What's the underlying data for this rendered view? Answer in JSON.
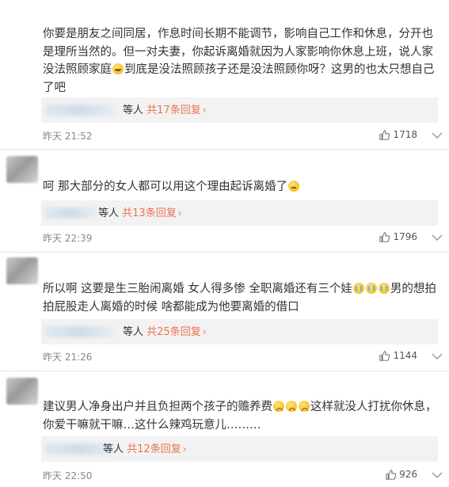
{
  "comments": [
    {
      "text_parts": [
        "你要是朋友之间同居，作息时间长期不能调节，影响自己工作和休息，分开也是理所当然的。但一对夫妻，你起诉离婚就因为人家影响你休息上班，说人家没法照顾家庭",
        "到底是没法照顾孩子还是没法照顾你呀？这男的也太只想自己了吧"
      ],
      "emoji_names": [
        "sweat-smile-emoji"
      ],
      "reply_suffix": "等人",
      "reply_count": "共17条回复",
      "time": "昨天 21:52",
      "likes": "1718"
    },
    {
      "text_parts": [
        "呵 那大部分的女人都可以用这个理由起诉离婚了",
        ""
      ],
      "emoji_names": [
        "thinking-emoji"
      ],
      "reply_suffix": "等人",
      "reply_count": "共13条回复",
      "time": "昨天 22:39",
      "likes": "1796"
    },
    {
      "text_parts": [
        "所以啊 这要是生三胎闹离婚 女人得多惨 全职离婚还有三个娃",
        "男的想拍拍屁股走人离婚的时候 啥都能成为他要离婚的借口"
      ],
      "emoji_names": [
        "crying-emoji",
        "crying-emoji",
        "crying-emoji"
      ],
      "reply_suffix": "等人",
      "reply_count": "共25条回复",
      "time": "昨天 21:26",
      "likes": "1144"
    },
    {
      "text_parts": [
        "建议男人净身出户并且负担两个孩子的赡养费",
        "这样就没人打扰你休息，你爱干嘛就干嘛…这什么辣鸡玩意儿………"
      ],
      "emoji_names": [
        "sad-emoji",
        "sad-emoji",
        "sad-emoji"
      ],
      "reply_suffix": "等人",
      "reply_count": "共12条回复",
      "time": "昨天 22:50",
      "likes": "926"
    }
  ],
  "colors": {
    "link": "#eb7350",
    "reply_bg": "#f2f2f2",
    "meta": "#888888"
  },
  "icons": {
    "like": "thumbs-up-icon",
    "more": "chevron-down-icon",
    "reply_more": "chevron-right-icon"
  }
}
